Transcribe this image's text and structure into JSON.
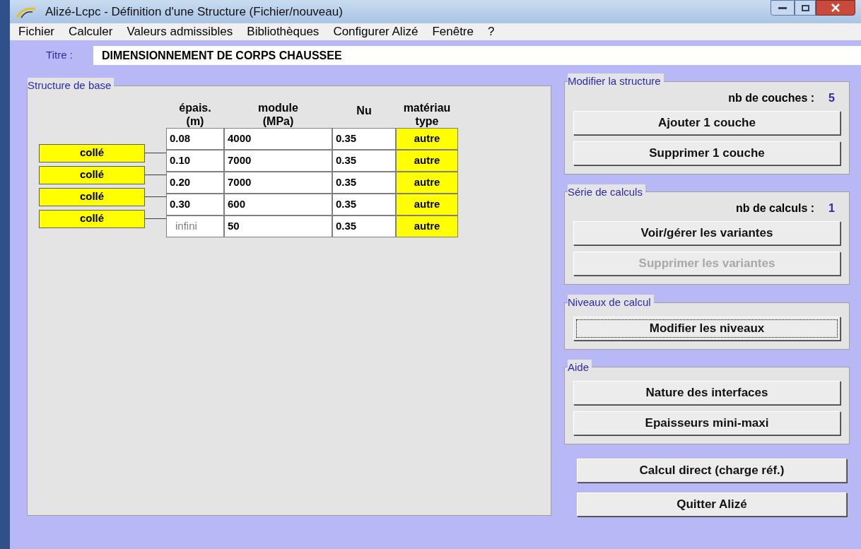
{
  "window": {
    "title": "Alizé-Lcpc - Définition d'une Structure (Fichier/nouveau)"
  },
  "menu": [
    "Fichier",
    "Calculer",
    "Valeurs admissibles",
    "Bibliothèques",
    "Configurer Alizé",
    "Fenêtre",
    "?"
  ],
  "title_field": {
    "label": "Titre :",
    "value": "DIMENSIONNEMENT DE CORPS CHAUSSEE"
  },
  "structure": {
    "legend": "Structure de base",
    "columns": [
      "épais.\n(m)",
      "module\n(MPa)",
      "Nu",
      "matériau\ntype"
    ],
    "interfaces": [
      "collé",
      "collé",
      "collé",
      "collé"
    ],
    "layers": [
      {
        "kind": "finite",
        "thickness": "0.08",
        "modulus": "4000",
        "nu": "0.35",
        "material": "autre"
      },
      {
        "kind": "finite",
        "thickness": "0.10",
        "modulus": "7000",
        "nu": "0.35",
        "material": "autre"
      },
      {
        "kind": "finite",
        "thickness": "0.20",
        "modulus": "7000",
        "nu": "0.35",
        "material": "autre"
      },
      {
        "kind": "finite",
        "thickness": "0.30",
        "modulus": "600",
        "nu": "0.35",
        "material": "autre"
      },
      {
        "kind": "infinite",
        "thickness": "infini",
        "modulus": "50",
        "nu": "0.35",
        "material": "autre"
      }
    ]
  },
  "groups": [
    {
      "legend": "Modifier la structure",
      "count_label": "nb de couches :",
      "count": "5",
      "buttons": [
        {
          "label": "Ajouter 1 couche",
          "disabled": false,
          "focused": false
        },
        {
          "label": "Supprimer 1 couche",
          "disabled": false,
          "focused": false
        }
      ]
    },
    {
      "legend": "Série de calculs",
      "count_label": "nb de calculs :",
      "count": "1",
      "buttons": [
        {
          "label": "Voir/gérer les variantes",
          "disabled": false,
          "focused": false
        },
        {
          "label": "Supprimer les variantes",
          "disabled": true,
          "focused": false
        }
      ]
    },
    {
      "legend": "Niveaux de calcul",
      "buttons": [
        {
          "label": "Modifier les niveaux",
          "disabled": false,
          "focused": true
        }
      ]
    },
    {
      "legend": "Aide",
      "buttons": [
        {
          "label": "Nature des interfaces",
          "disabled": false,
          "focused": false
        },
        {
          "label": "Epaisseurs mini-maxi",
          "disabled": false,
          "focused": false
        }
      ]
    }
  ],
  "bottom_buttons": [
    {
      "label": "Calcul direct (charge réf.)",
      "disabled": false,
      "focused": false
    },
    {
      "label": "Quitter Alizé",
      "disabled": false,
      "focused": false
    }
  ]
}
